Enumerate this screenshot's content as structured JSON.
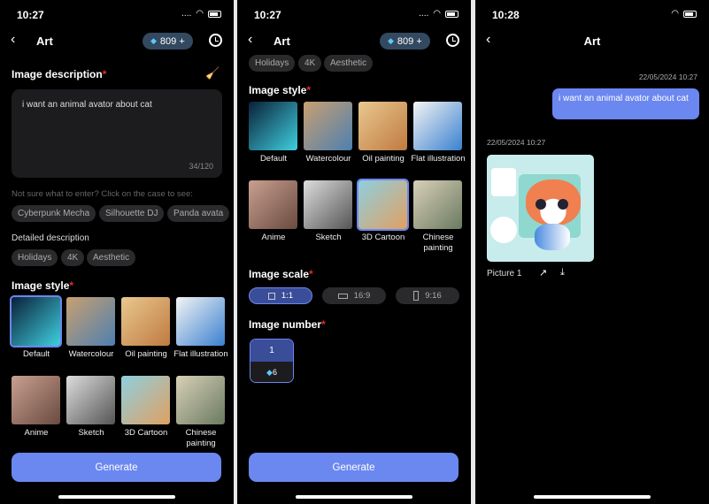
{
  "status": {
    "time1": "10:27",
    "time2": "10:27",
    "time3": "10:28"
  },
  "header": {
    "title": "Art",
    "credits": "809 +"
  },
  "form": {
    "description_label": "Image description",
    "required_mark": "*",
    "description_value": "i want an animal avator about cat",
    "counter": "34/120",
    "hint": "Not sure what to enter? Click on the case to see:",
    "cases": [
      "Cyberpunk Mecha",
      "Silhouette DJ",
      "Panda avata"
    ],
    "detailed_label": "Detailed description",
    "details": [
      "Holidays",
      "4K",
      "Aesthetic"
    ],
    "style_label": "Image style",
    "styles": [
      {
        "label": "Default",
        "colors": [
          "#0a2038",
          "#3fd0e0"
        ],
        "selected": true
      },
      {
        "label": "Watercolour",
        "colors": [
          "#c8a070",
          "#4e7fb0"
        ]
      },
      {
        "label": "Oil painting",
        "colors": [
          "#e8c890",
          "#c07a40"
        ]
      },
      {
        "label": "Flat illustration",
        "colors": [
          "#f4f4f4",
          "#3a80d0"
        ]
      },
      {
        "label": "Anime",
        "colors": [
          "#c8a090",
          "#6a4a40"
        ]
      },
      {
        "label": "Sketch",
        "colors": [
          "#dddddd",
          "#555555"
        ]
      },
      {
        "label": "3D Cartoon",
        "colors": [
          "#8fcfe0",
          "#e0a060"
        ],
        "selected2": true
      },
      {
        "label": "Chinese painting",
        "colors": [
          "#d8d0b8",
          "#6a7a60"
        ]
      }
    ],
    "scale_label": "Image scale",
    "scales": [
      "1:1",
      "16:9",
      "9:16"
    ],
    "number_label": "Image number",
    "number_value": "1",
    "number_cost": "6",
    "generate": "Generate"
  },
  "chat": {
    "user_time": "22/05/2024 10:27",
    "user_message": "i want an animal avator about cat",
    "bot_time": "22/05/2024 10:27",
    "picture_label": "Picture 1"
  },
  "colors": {
    "accent": "#6b87f0",
    "required": "#e0302a"
  }
}
